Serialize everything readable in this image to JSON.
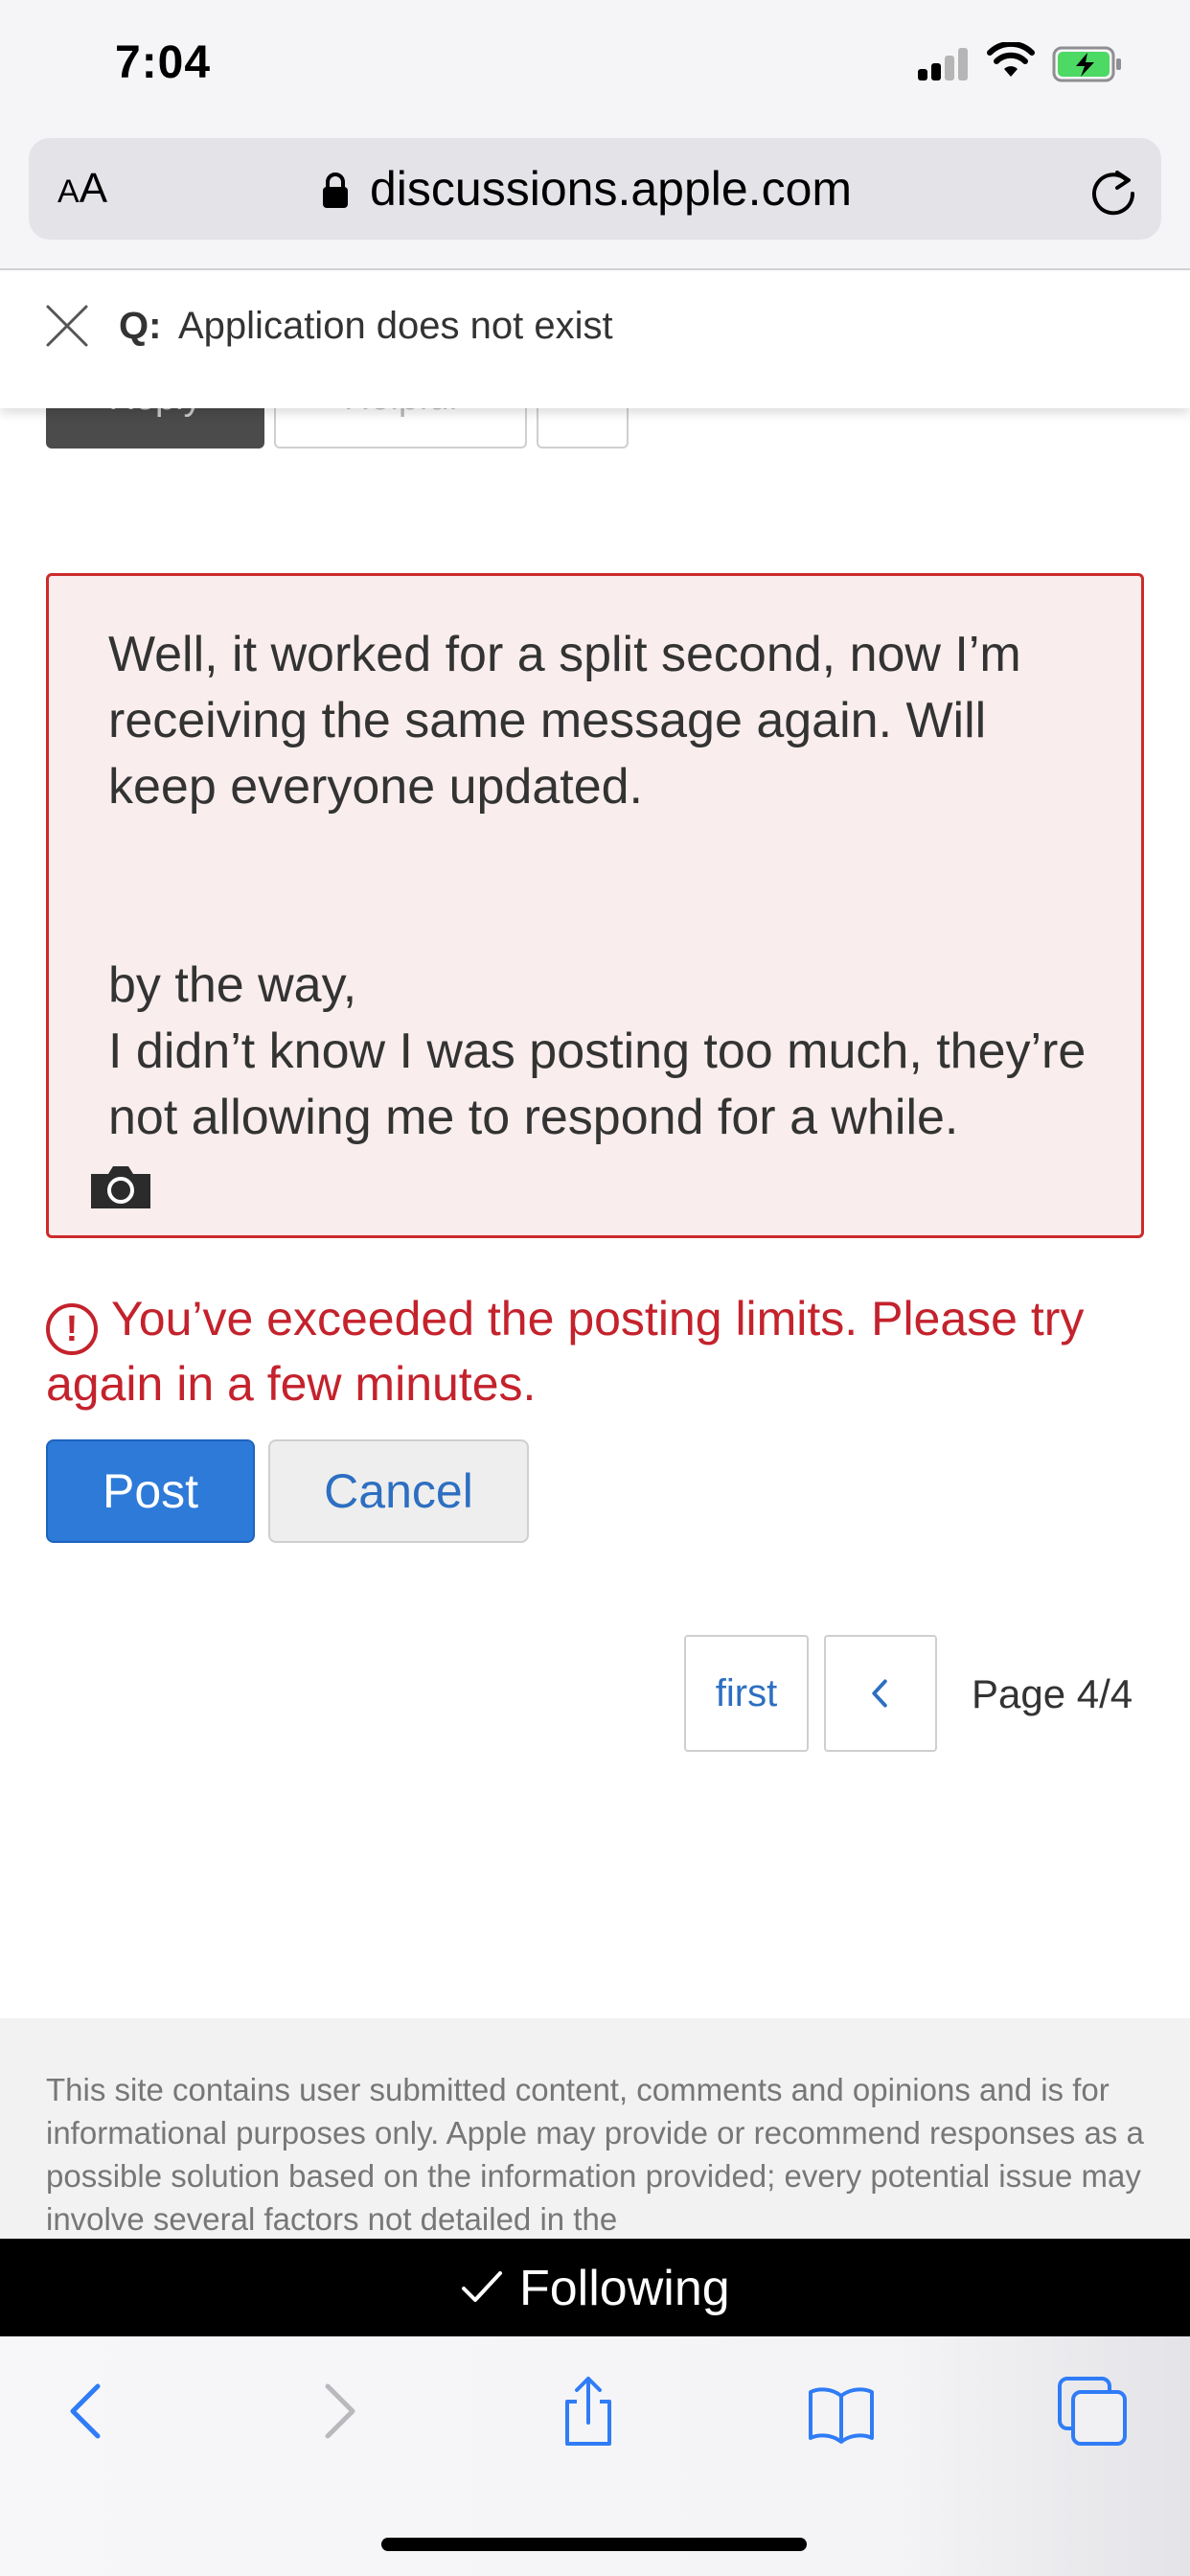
{
  "status_bar": {
    "time": "7:04"
  },
  "browser": {
    "text_size_label_small": "A",
    "text_size_label_large": "A",
    "domain": "discussions.apple.com"
  },
  "question": {
    "prefix": "Q:",
    "title": "Application does not exist"
  },
  "partial_buttons": {
    "reply": "Reply",
    "helpful": "Helpful"
  },
  "reply": {
    "paragraph1": "Well, it worked for a split second, now I’m receiving the same message again. Will keep everyone updated.",
    "line2": "by the way,",
    "line3": "I didn’t know I was posting too much, they’re not allowing me to respond for a while."
  },
  "error": {
    "icon": "!",
    "message": "You’ve exceeded the posting limits. Please try again in a few minutes."
  },
  "actions": {
    "post": "Post",
    "cancel": "Cancel"
  },
  "pagination": {
    "first": "first",
    "prev_icon": "chevron-left-icon",
    "label": "Page 4/4"
  },
  "footer": {
    "text": "This site contains user submitted content, comments and opinions and is for informational purposes only. Apple may provide or recommend responses as a possible solution based on the information provided; every potential issue may involve several factors not detailed in the"
  },
  "following_bar": {
    "label": "Following"
  },
  "toolbar": {
    "icons": [
      "back-icon",
      "forward-icon",
      "share-icon",
      "bookmarks-icon",
      "tabs-icon"
    ]
  },
  "colors": {
    "error_red": "#c4222c",
    "link_blue": "#2d6fc1",
    "post_blue": "#2d7ad8",
    "ios_blue": "#2f7cf6",
    "battery_green": "#4cd964"
  }
}
